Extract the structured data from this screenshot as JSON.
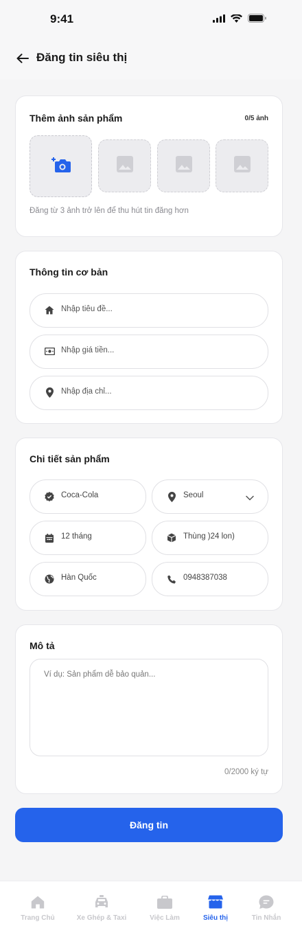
{
  "status_bar": {
    "time": "9:41"
  },
  "header": {
    "title": "Đăng tin siêu thị"
  },
  "photos": {
    "title": "Thêm ảnh sản phẩm",
    "count": "0/5 ảnh",
    "hint": "Đăng từ 3 ảnh trở lên để thu hút tin đăng hơn"
  },
  "basic_info": {
    "title": "Thông tin cơ bản",
    "title_placeholder": "Nhập tiêu đề...",
    "price_placeholder": "Nhập giá tiền...",
    "address_placeholder": "Nhập địa chỉ..."
  },
  "details": {
    "title": "Chi tiết sản phẩm",
    "brand": "Coca-Cola",
    "location": "Seoul",
    "expiry": "12 tháng",
    "packaging": "Thùng )24 lon)",
    "origin": "Hàn Quốc",
    "phone": "0948387038"
  },
  "description": {
    "title": "Mô tả",
    "placeholder": "Ví dụ: Sản phẩm dễ bảo quản...",
    "char_count": "0/2000 ký tự"
  },
  "submit_label": "Đăng tin",
  "bottom_nav": {
    "items": [
      {
        "label": "Trang Chủ",
        "icon": "home-icon"
      },
      {
        "label": "Xe Ghép & Taxi",
        "icon": "taxi-icon"
      },
      {
        "label": "Việc Làm",
        "icon": "briefcase-icon"
      },
      {
        "label": "Siêu thị",
        "icon": "store-icon",
        "active": true
      },
      {
        "label": "Tin Nhắn",
        "icon": "chat-icon"
      }
    ]
  },
  "colors": {
    "accent": "#2563eb",
    "background": "#f5f5f6",
    "inactive_nav": "#c8c8cc"
  }
}
